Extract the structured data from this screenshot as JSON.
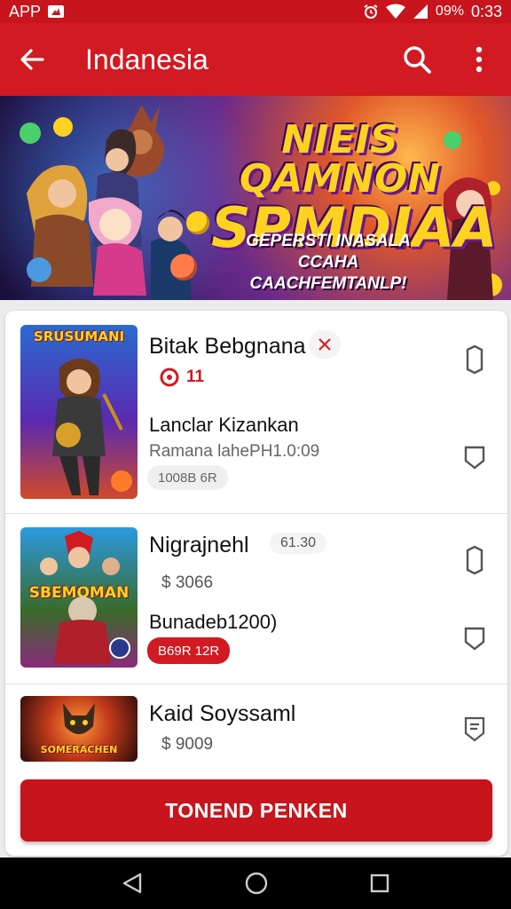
{
  "status_bar": {
    "left_label": "APP",
    "battery": "09%",
    "time": "0:33"
  },
  "app_bar": {
    "title": "Indanesia",
    "icons": [
      "back-arrow-icon",
      "search-icon",
      "more-vert-icon"
    ]
  },
  "banner": {
    "heading_line1": "NIEIS QAMNON",
    "heading_line2": "SPMDIAA",
    "subtitle_line1": "GEPERSTI INASALA CCAHA",
    "subtitle_line2": "CAACHFEMTANLP!"
  },
  "items": [
    {
      "thumb_title": "SRUSUMANI",
      "thumb_badge": "",
      "name": "Bitak Bebgnana",
      "rating": "11",
      "subtitle": "Lanclar Kizankan",
      "meta": "Ramana lahePH1.0:09",
      "chip": "1008B 6R"
    },
    {
      "thumb_title": "SBEMOMAN",
      "thumb_badge": "",
      "name": "Nigrajnehl",
      "tag": "61.30",
      "price": "$ 3066",
      "subtitle": "Bunadeb1200)",
      "chip": "B69R 12R"
    },
    {
      "thumb_title": "SOMERACHEN",
      "name": "Kaid Soyssaml",
      "price": "$ 9009"
    }
  ],
  "cta_label": "TONEND PENKEN",
  "colors": {
    "primary": "#d11a22",
    "status": "#c8141c",
    "accent_gold": "#ffd21f"
  },
  "nav": [
    "back-triangle-icon",
    "home-circle-icon",
    "recents-square-icon"
  ]
}
